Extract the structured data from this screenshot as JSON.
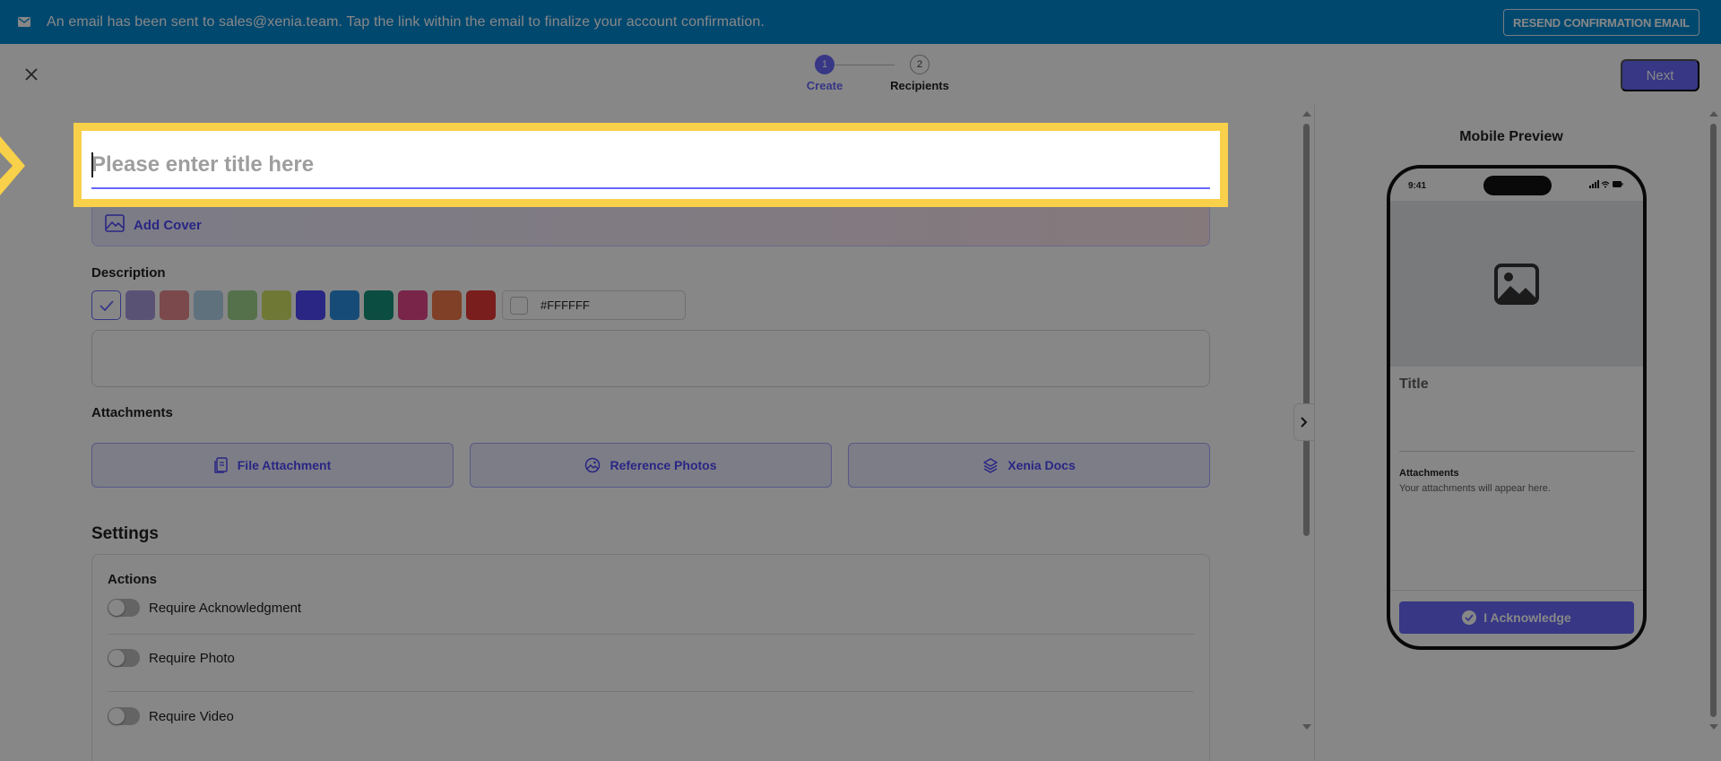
{
  "banner": {
    "message": "An email has been sent to sales@xenia.team. Tap the link within the email to finalize your account confirmation.",
    "resend_label": "RESEND CONFIRMATION EMAIL"
  },
  "header": {
    "steps": [
      {
        "number": "1",
        "label": "Create"
      },
      {
        "number": "2",
        "label": "Recipients"
      }
    ],
    "next_label": "Next"
  },
  "form": {
    "title_placeholder": "Please enter title here",
    "add_cover_label": "Add Cover",
    "description_label": "Description",
    "swatch_colors": [
      "#ffffff",
      "#a89bdd",
      "#e88b8f",
      "#b6d6ef",
      "#9fd68f",
      "#d4e366",
      "#4e48fa",
      "#2d8fe0",
      "#16917c",
      "#e2468a",
      "#f07a4a",
      "#e53935"
    ],
    "hex_value": "#FFFFFF",
    "attachments_label": "Attachments",
    "attachment_buttons": [
      "File Attachment",
      "Reference Photos",
      "Xenia Docs"
    ],
    "settings_label": "Settings",
    "actions_label": "Actions",
    "toggles": [
      "Require Acknowledgment",
      "Require Photo",
      "Require Video"
    ]
  },
  "preview": {
    "heading": "Mobile Preview",
    "time": "9:41",
    "title_placeholder": "Title",
    "attachments_title": "Attachments",
    "attachments_hint": "Your attachments will appear here.",
    "ack_label": "I Acknowledge"
  },
  "colors": {
    "accent": "#6868fe",
    "banner": "#0288d1",
    "highlight": "#f8d049"
  }
}
